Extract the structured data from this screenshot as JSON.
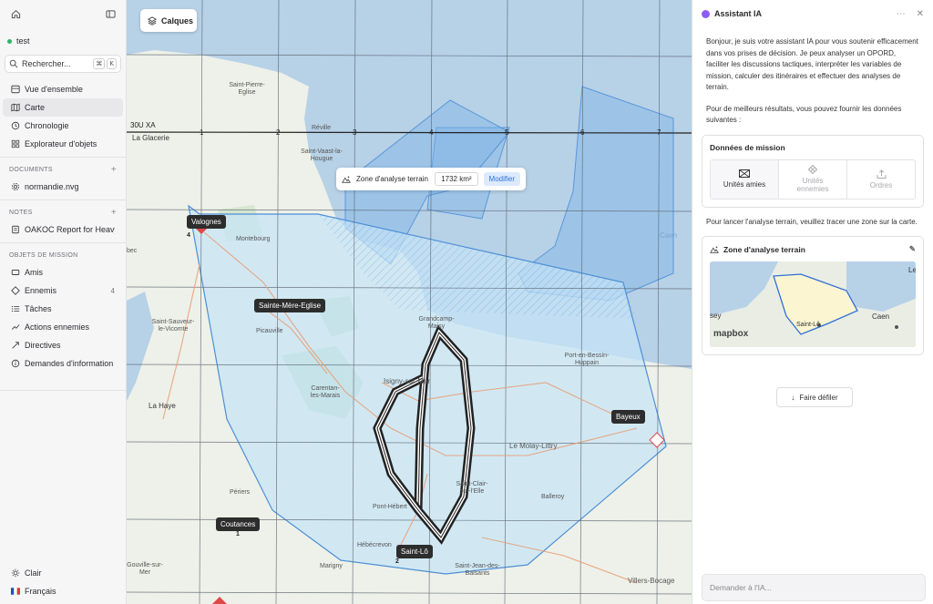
{
  "sidebar": {
    "workspace": "test",
    "search": {
      "label": "Rechercher...",
      "shortcut": [
        "⌘",
        "K"
      ]
    },
    "nav": [
      {
        "label": "Vue d'ensemble",
        "icon": "overview-icon"
      },
      {
        "label": "Carte",
        "icon": "map-icon",
        "active": true
      },
      {
        "label": "Chronologie",
        "icon": "timeline-icon"
      },
      {
        "label": "Explorateur d'objets",
        "icon": "grid-icon"
      }
    ],
    "documents": {
      "title": "DOCUMENTS",
      "items": [
        {
          "label": "normandie.nvg",
          "icon": "gear-icon"
        }
      ]
    },
    "notes": {
      "title": "NOTES",
      "items": [
        {
          "label": "OAKOC Report for Heavy ...",
          "icon": "note-icon"
        }
      ]
    },
    "mission_objects": {
      "title": "OBJETS DE MISSION",
      "items": [
        {
          "label": "Amis",
          "icon": "friends-icon",
          "count": ""
        },
        {
          "label": "Ennemis",
          "icon": "enemy-icon",
          "count": "4"
        },
        {
          "label": "Tâches",
          "icon": "tasks-icon",
          "count": ""
        },
        {
          "label": "Actions ennemies",
          "icon": "enemy-actions-icon",
          "count": ""
        },
        {
          "label": "Directives",
          "icon": "directives-icon",
          "count": ""
        },
        {
          "label": "Demandes d'information",
          "icon": "info-request-icon",
          "count": ""
        }
      ]
    },
    "bottom": {
      "theme": "Clair",
      "language": "Français"
    }
  },
  "map": {
    "layers_button": "Calques",
    "zone_toolbar": {
      "title": "Zone d'analyse terrain",
      "area": "1732 km²",
      "modify": "Modifier"
    },
    "grid": {
      "zone_label": "30U XA",
      "col_labels": [
        "1",
        "2",
        "3",
        "4",
        "5",
        "6",
        "7"
      ]
    },
    "city_tags": [
      {
        "name": "Valognes",
        "count": "4"
      },
      {
        "name": "Sainte-Mère-Eglise",
        "count": ""
      },
      {
        "name": "Bayeux",
        "count": ""
      },
      {
        "name": "Coutances",
        "count": "1"
      },
      {
        "name": "Saint-Lô",
        "count": "2"
      }
    ],
    "places": [
      "Saint-Pierre-Eglise",
      "Réville",
      "La Glacerie",
      "Saint-Vaast-la-Hougue",
      "Montebourg",
      "Picauville",
      "Saint-Sauveur-le-Vicomte",
      "Carentan-les-Marais",
      "Isigny-sur-Mer",
      "Grandcamp-Maisy",
      "Port-en-Bessin-Huppain",
      "Le Molay-Littry",
      "Saint-Clair-sur-l'Elle",
      "Pont-Hébert",
      "Balleroy",
      "La Haye",
      "Périers",
      "Hébécrevon",
      "Marigny",
      "Saint-Jean-des-Baisants",
      "Gouville-sur-Mer",
      "Villers-Bocage",
      "Caen",
      "bec"
    ]
  },
  "assistant": {
    "title": "Assistant IA",
    "intro": "Bonjour, je suis votre assistant IA pour vous soutenir efficacement dans vos prises de décision. Je peux analyser un OPORD, faciliter les discussions tactiques, interpréter les variables de mission, calculer des itinéraires et effectuer des analyses de terrain.",
    "hint": "Pour de meilleurs résultats, vous pouvez fournir les données suivantes :",
    "mission_card": {
      "title": "Données de mission",
      "choices": [
        {
          "label": "Unités amies",
          "state": "active",
          "icon": "friendly-unit-icon"
        },
        {
          "label": "Unités ennemies",
          "state": "disabled",
          "icon": "enemy-unit-icon"
        },
        {
          "label": "Ordres",
          "state": "disabled",
          "icon": "orders-icon"
        }
      ]
    },
    "draw_prompt": "Pour lancer l'analyse terrain, veuillez tracer une zone sur la carte.",
    "zone_card": {
      "title": "Zone d'analyse terrain",
      "mini_labels": [
        "sey",
        "Le",
        "Caen",
        "Saint-Lô",
        "mapbox"
      ]
    },
    "scroll_button": "Faire défiler",
    "ask_placeholder": "Demander à l'IA..."
  },
  "colors": {
    "accent": "#2f6fd6",
    "zone_fill": "#bfe0f5",
    "zone_stroke": "#4d8fd6",
    "sea": "#b5cfe6",
    "ai": "#8b5cf6"
  }
}
